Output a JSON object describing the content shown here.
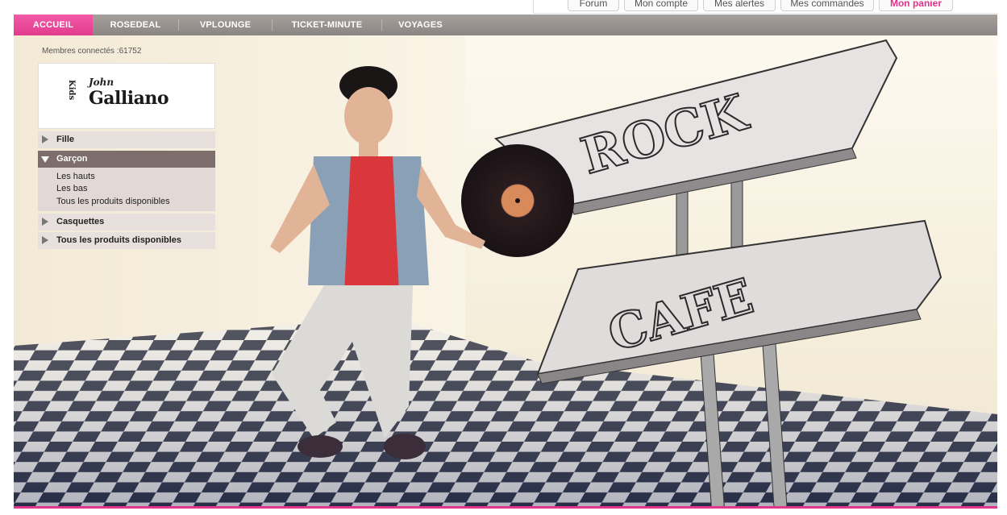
{
  "top_links": [
    {
      "label": "Forum"
    },
    {
      "label": "Mon compte"
    },
    {
      "label": "Mes alertes"
    },
    {
      "label": "Mes commandes"
    },
    {
      "label": "Mon panier"
    }
  ],
  "nav": [
    {
      "label": "ACCUEIL",
      "active": true
    },
    {
      "label": "ROSEDEAL"
    },
    {
      "label": "VPLOUNGE"
    },
    {
      "label": "TICKET-MINUTE"
    },
    {
      "label": "VOYAGES"
    }
  ],
  "members_text": "Membres connectés :61752",
  "brand": {
    "kids": "Kids",
    "john": "John",
    "name": "Galliano"
  },
  "categories": {
    "fille": "Fille",
    "garcon": "Garçon",
    "garcon_sub": [
      "Les hauts",
      "Les bas",
      "Tous les produits disponibles"
    ],
    "casquettes": "Casquettes",
    "all": "Tous les produits disponibles"
  },
  "sign": {
    "top": "ROCK",
    "bottom": "CAFE"
  },
  "colors": {
    "accent": "#e4358c",
    "nav": "#9a9491"
  }
}
